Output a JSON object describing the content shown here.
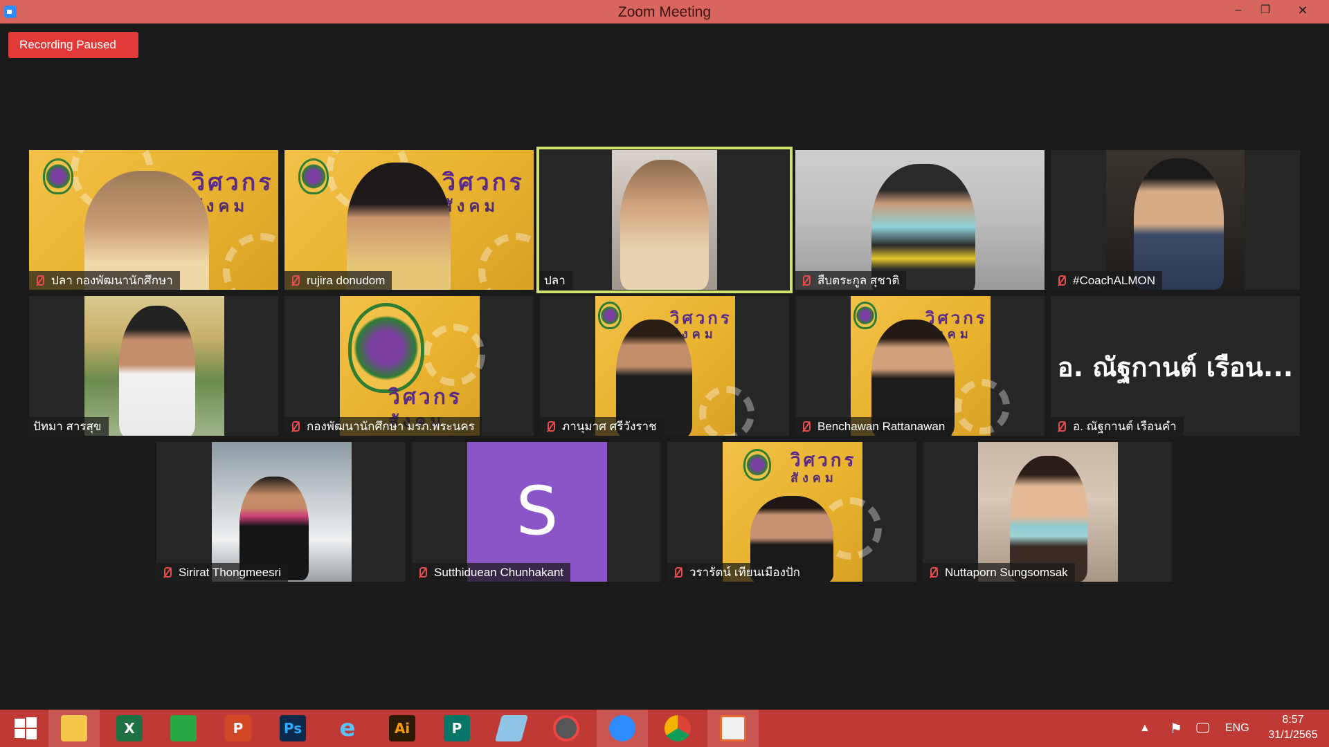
{
  "window": {
    "title": "Zoom Meeting",
    "min_glyph": "–",
    "max_glyph": "❐",
    "close_glyph": "✕"
  },
  "recording": {
    "label": "Recording Paused"
  },
  "participants": [
    {
      "name": "ปลา กองพัฒนานักศึกษา",
      "muted": true
    },
    {
      "name": "rujira donudom",
      "muted": true
    },
    {
      "name": "ปลา",
      "muted": false,
      "active_speaker": true
    },
    {
      "name": "สืบตระกูล สุชาติ",
      "muted": true
    },
    {
      "name": "#CoachALMON",
      "muted": true
    },
    {
      "name": "ปัทมา สารสุข",
      "muted": false
    },
    {
      "name": "กองพัฒนานักศึกษา มรภ.พระนคร",
      "muted": true
    },
    {
      "name": "ภานุมาศ ศรีวังราช",
      "muted": true
    },
    {
      "name": "Benchawan Rattanawan",
      "muted": true
    },
    {
      "name": "อ. ณัฐกานต์ เรือนคำ",
      "muted": true,
      "display_name": "อ. ณัฐกานต์ เรือน..."
    },
    {
      "name": "Sirirat Thongmeesri",
      "muted": true
    },
    {
      "name": "Sutthiduean Chunhakant",
      "muted": true,
      "avatar_letter": "S",
      "avatar_color": "#8a55c7"
    },
    {
      "name": "วรารัตน์ เทียนเมืองปัก",
      "muted": true
    },
    {
      "name": "Nuttaporn Sungsomsak",
      "muted": true
    }
  ],
  "poster": {
    "line1": "วิศวกร",
    "line2": "สังคม"
  },
  "taskbar": {
    "items": [
      {
        "icon": "windows-start-icon",
        "label": ""
      },
      {
        "icon": "file-explorer-icon",
        "label": ""
      },
      {
        "icon": "excel-icon",
        "label": "X"
      },
      {
        "icon": "store-icon",
        "label": ""
      },
      {
        "icon": "powerpoint-icon",
        "label": "P"
      },
      {
        "icon": "photoshop-icon",
        "label": "Ps"
      },
      {
        "icon": "internet-explorer-icon",
        "label": "e"
      },
      {
        "icon": "illustrator-icon",
        "label": "Ai"
      },
      {
        "icon": "publisher-icon",
        "label": "P"
      },
      {
        "icon": "notepad-icon",
        "label": ""
      },
      {
        "icon": "photoscape-icon",
        "label": ""
      },
      {
        "icon": "zoom-icon",
        "label": ""
      },
      {
        "icon": "chrome-icon",
        "label": ""
      },
      {
        "icon": "photos-icon",
        "label": ""
      }
    ],
    "language": "ENG",
    "time": "8:57",
    "date": "31/1/2565"
  },
  "colors": {
    "titlebar": "#d9655f",
    "taskbar": "#bf3a34",
    "recording": "#e23a38",
    "active_outline": "#cfe26a",
    "poster": "#f2c14a"
  }
}
